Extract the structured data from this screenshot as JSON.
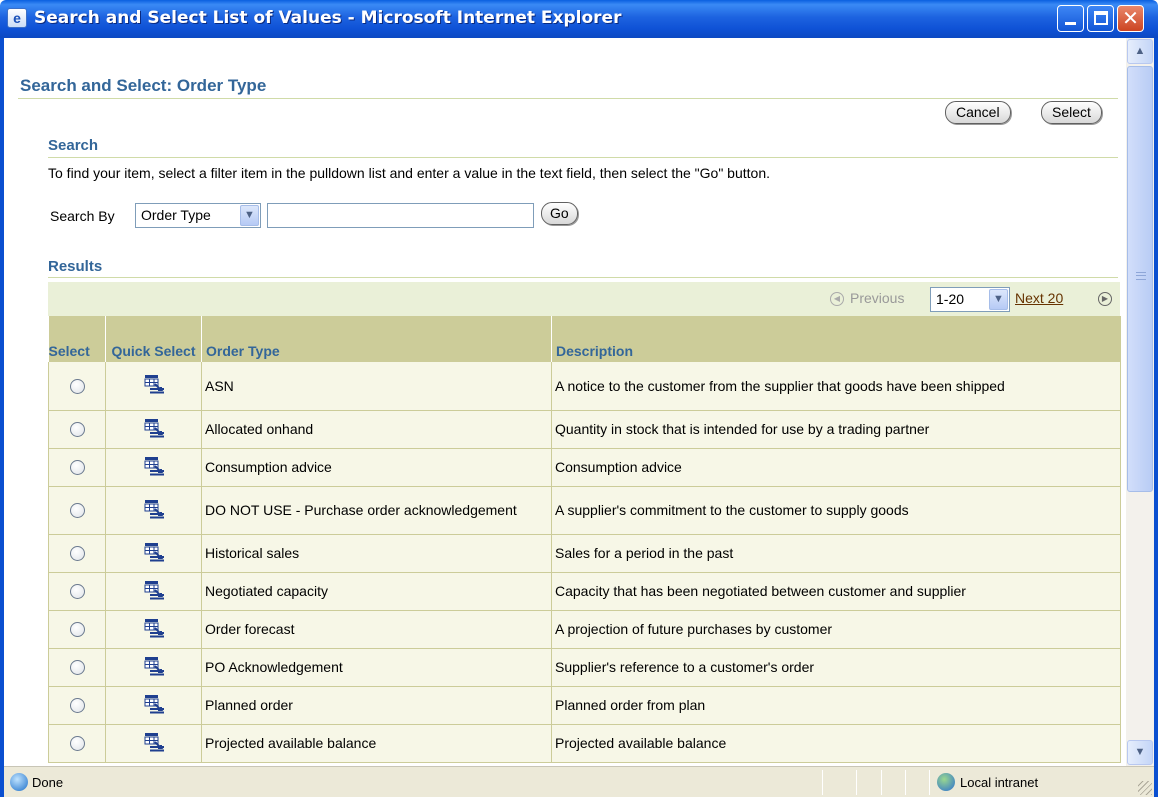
{
  "window": {
    "title": "Search and Select List of Values - Microsoft Internet Explorer"
  },
  "page": {
    "title": "Search and Select: Order Type",
    "cancel_label": "Cancel",
    "select_label": "Select"
  },
  "search": {
    "section_title": "Search",
    "instructions": "To find your item, select a filter item in the pulldown list and enter a value in the text field, then select the \"Go\" button.",
    "search_by_label": "Search By",
    "filter_value": "Order Type",
    "text_value": "",
    "go_label": "Go"
  },
  "results": {
    "section_title": "Results",
    "previous_label": "Previous",
    "range_value": "1-20",
    "next_label": "Next 20",
    "columns": {
      "select": "Select",
      "quick_select": "Quick Select",
      "order_type": "Order Type",
      "description": "Description"
    },
    "rows": [
      {
        "order_type": "ASN",
        "description": "A notice to the customer from the supplier that goods have been shipped"
      },
      {
        "order_type": "Allocated onhand",
        "description": "Quantity in stock that is intended for use by a trading partner"
      },
      {
        "order_type": "Consumption advice",
        "description": "Consumption advice"
      },
      {
        "order_type": "DO NOT USE - Purchase order acknowledgement",
        "description": "A supplier's commitment to the customer to supply goods"
      },
      {
        "order_type": "Historical sales",
        "description": "Sales for a period in the past"
      },
      {
        "order_type": "Negotiated capacity",
        "description": "Capacity that has been negotiated between customer and supplier"
      },
      {
        "order_type": "Order forecast",
        "description": "A projection of future purchases by customer"
      },
      {
        "order_type": "PO Acknowledgement",
        "description": "Supplier's reference to a customer's order"
      },
      {
        "order_type": "Planned order",
        "description": "Planned order from plan"
      },
      {
        "order_type": "Projected available balance",
        "description": "Projected available balance"
      }
    ]
  },
  "statusbar": {
    "status": "Done",
    "zone": "Local intranet"
  },
  "icons": {
    "window_icon": "ie-page-icon",
    "quick_select": "quick-select-icon",
    "status": "ie-done-icon",
    "zone": "local-intranet-icon"
  },
  "colors": {
    "title_bar": "#0c52d8",
    "header_text": "#336699",
    "table_header_bg": "#cccc99",
    "row_bg": "#f7f7e7",
    "link": "#663300"
  }
}
